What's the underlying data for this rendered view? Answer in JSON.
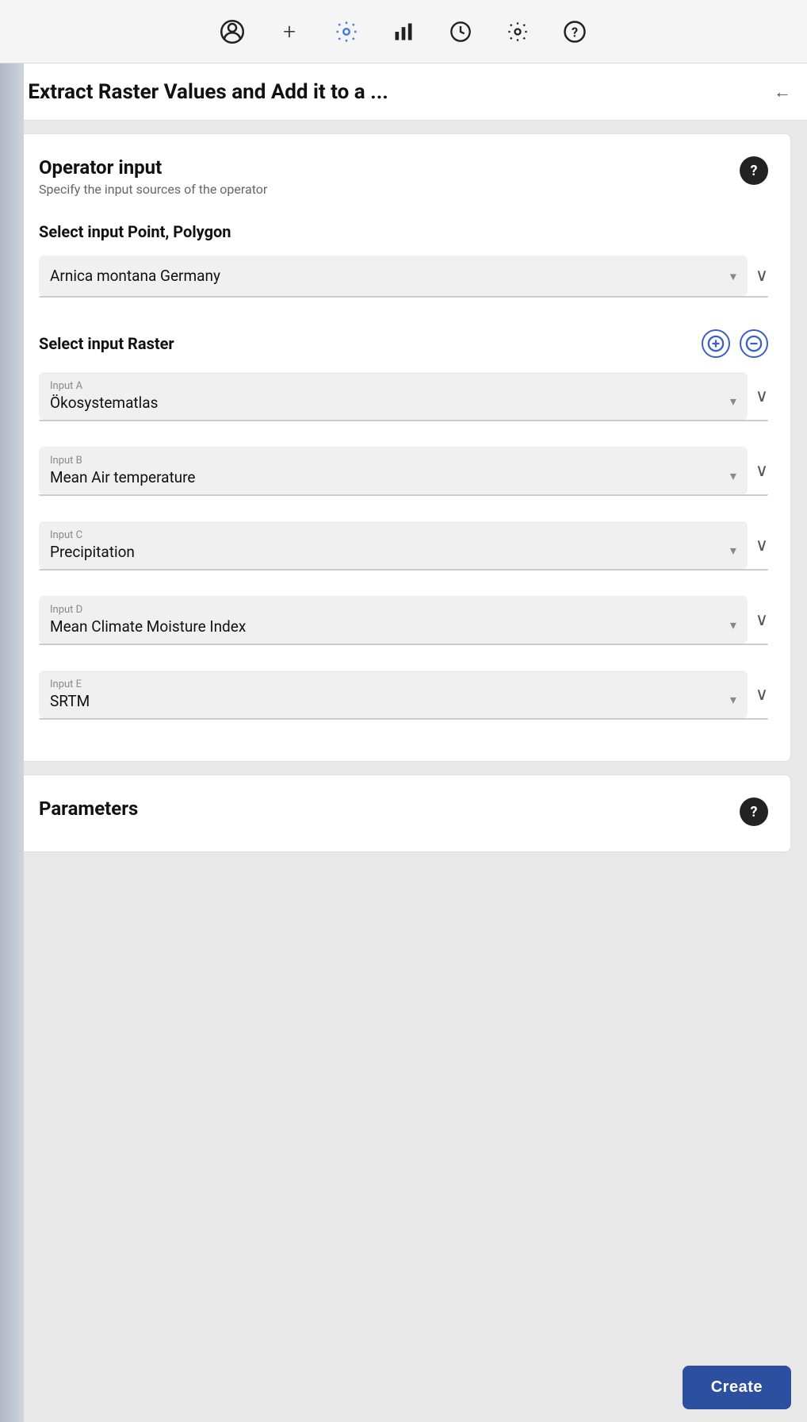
{
  "toolbar": {
    "icons": [
      {
        "name": "user-icon",
        "symbol": "👤"
      },
      {
        "name": "plus-icon",
        "symbol": "+"
      },
      {
        "name": "settings-animated-icon",
        "symbol": "⚙"
      },
      {
        "name": "chart-icon",
        "symbol": "📊"
      },
      {
        "name": "clock-icon",
        "symbol": "🕐"
      },
      {
        "name": "gear-icon",
        "symbol": "⚙"
      },
      {
        "name": "help-circle-icon",
        "symbol": "?"
      }
    ]
  },
  "breadcrumb": {
    "title": "Extract Raster Values and Add it to a ...",
    "back_arrow": "←",
    "chevron": "›"
  },
  "operator_input": {
    "title": "Operator input",
    "subtitle": "Specify the input sources of the operator",
    "help_label": "?",
    "select_point_polygon_label": "Select input Point, Polygon",
    "point_polygon_value": "Arnica montana Germany",
    "select_raster_label": "Select input Raster",
    "inputs": [
      {
        "id": "A",
        "label": "Input A",
        "value": "Ökosystematlas"
      },
      {
        "id": "B",
        "label": "Input B",
        "value": "Mean Air temperature"
      },
      {
        "id": "C",
        "label": "Input C",
        "value": "Precipitation"
      },
      {
        "id": "D",
        "label": "Input D",
        "value": "Mean Climate Moisture Index"
      },
      {
        "id": "E",
        "label": "Input E",
        "value": "SRTM"
      }
    ]
  },
  "parameters": {
    "title": "Parameters",
    "help_label": "?"
  },
  "create_button": {
    "label": "Create"
  }
}
